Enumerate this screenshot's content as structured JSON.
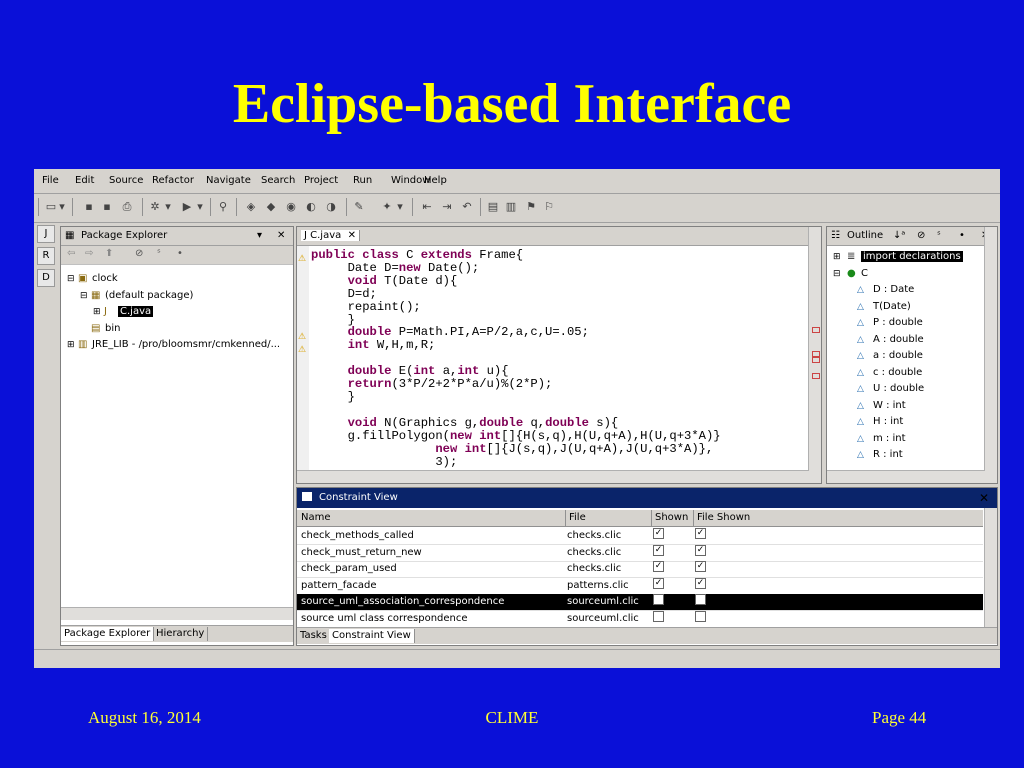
{
  "slide": {
    "title": "Eclipse-based Interface",
    "date": "August 16, 2014",
    "center": "CLIME",
    "page": "Page 44"
  },
  "menu": [
    "File",
    "Edit",
    "Source",
    "Refactor",
    "Navigate",
    "Search",
    "Project",
    "Run",
    "Window",
    "Help"
  ],
  "package_explorer": {
    "title": "Package Explorer",
    "tree": [
      {
        "label": "clock",
        "indent": 1,
        "toggle": "⊟",
        "icon": "project-icon"
      },
      {
        "label": "(default package)",
        "indent": 2,
        "toggle": "⊟",
        "icon": "package-icon"
      },
      {
        "label": "C.java",
        "indent": 3,
        "toggle": "⊞",
        "icon": "java-file-icon",
        "selected": true
      },
      {
        "label": "bin",
        "indent": 2,
        "toggle": "",
        "icon": "folder-icon"
      },
      {
        "label": "JRE_LIB - /pro/bloomsmr/cmkenned/...",
        "indent": 1,
        "toggle": "⊞",
        "icon": "library-icon"
      }
    ],
    "tabs": [
      "Package Explorer",
      "Hierarchy"
    ]
  },
  "editor": {
    "tab": "C.java",
    "code": [
      [
        [
          "kw",
          "public class"
        ],
        [
          "t",
          " C "
        ],
        [
          "kw",
          "extends"
        ],
        [
          "t",
          " Frame{"
        ]
      ],
      [
        [
          "t",
          "     Date D="
        ],
        [
          "kw",
          "new"
        ],
        [
          "t",
          " Date();"
        ]
      ],
      [
        [
          "t",
          "     "
        ],
        [
          "kw",
          "void"
        ],
        [
          "t",
          " T(Date d){"
        ]
      ],
      [
        [
          "t",
          "     D=d;"
        ]
      ],
      [
        [
          "t",
          "     repaint();"
        ]
      ],
      [
        [
          "t",
          "     }"
        ]
      ],
      [
        [
          "t",
          "     "
        ],
        [
          "kw",
          "double"
        ],
        [
          "t",
          " P=Math.PI,A=P/2,a,c,U=.05;"
        ]
      ],
      [
        [
          "t",
          "     "
        ],
        [
          "kw",
          "int"
        ],
        [
          "t",
          " W,H,m,R;"
        ]
      ],
      [
        [
          "t",
          ""
        ]
      ],
      [
        [
          "t",
          "     "
        ],
        [
          "kw",
          "double"
        ],
        [
          "t",
          " E("
        ],
        [
          "kw",
          "int"
        ],
        [
          "t",
          " a,"
        ],
        [
          "kw",
          "int"
        ],
        [
          "t",
          " u){"
        ]
      ],
      [
        [
          "t",
          "     "
        ],
        [
          "kw",
          "return"
        ],
        [
          "t",
          "(3*P/2+2*P*a/u)%(2*P);"
        ]
      ],
      [
        [
          "t",
          "     }"
        ]
      ],
      [
        [
          "t",
          ""
        ]
      ],
      [
        [
          "t",
          "     "
        ],
        [
          "kw",
          "void"
        ],
        [
          "t",
          " N(Graphics g,"
        ],
        [
          "kw",
          "double"
        ],
        [
          "t",
          " q,"
        ],
        [
          "kw",
          "double"
        ],
        [
          "t",
          " s){"
        ]
      ],
      [
        [
          "t",
          "     g.fillPolygon("
        ],
        [
          "kw",
          "new int"
        ],
        [
          "t",
          "[]{H(s,q),H(U,q+A),H(U,q+3*A)}"
        ]
      ],
      [
        [
          "t",
          "                 "
        ],
        [
          "kw",
          "new int"
        ],
        [
          "t",
          "[]{J(s,q),J(U,q+A),J(U,q+3*A)},"
        ]
      ],
      [
        [
          "t",
          "                 3);"
        ]
      ]
    ]
  },
  "outline": {
    "title": "Outline",
    "items": [
      {
        "label": "import declarations",
        "indent": 0,
        "toggle": "⊞",
        "selected": true
      },
      {
        "label": "C",
        "indent": 0,
        "toggle": "⊟"
      },
      {
        "label": "D : Date",
        "indent": 1
      },
      {
        "label": "T(Date)",
        "indent": 1
      },
      {
        "label": "P : double",
        "indent": 1
      },
      {
        "label": "A : double",
        "indent": 1
      },
      {
        "label": "a : double",
        "indent": 1
      },
      {
        "label": "c : double",
        "indent": 1
      },
      {
        "label": "U : double",
        "indent": 1
      },
      {
        "label": "W : int",
        "indent": 1
      },
      {
        "label": "H : int",
        "indent": 1
      },
      {
        "label": "m : int",
        "indent": 1
      },
      {
        "label": "R : int",
        "indent": 1
      }
    ]
  },
  "constraint_view": {
    "title": "Constraint View",
    "columns": [
      "Name",
      "File",
      "Shown",
      "File Shown"
    ],
    "rows": [
      {
        "name": "check_methods_called",
        "file": "checks.clic",
        "shown": true,
        "file_shown": true
      },
      {
        "name": "check_must_return_new",
        "file": "checks.clic",
        "shown": true,
        "file_shown": true
      },
      {
        "name": "check_param_used",
        "file": "checks.clic",
        "shown": true,
        "file_shown": true
      },
      {
        "name": "pattern_facade",
        "file": "patterns.clic",
        "shown": true,
        "file_shown": true
      },
      {
        "name": "source_uml_association_correspondence",
        "file": "sourceuml.clic",
        "shown": false,
        "file_shown": false,
        "selected": true
      },
      {
        "name": "source uml class correspondence",
        "file": "sourceuml.clic",
        "shown": false,
        "file_shown": false
      }
    ],
    "tabs": [
      "Tasks",
      "Constraint View"
    ]
  }
}
